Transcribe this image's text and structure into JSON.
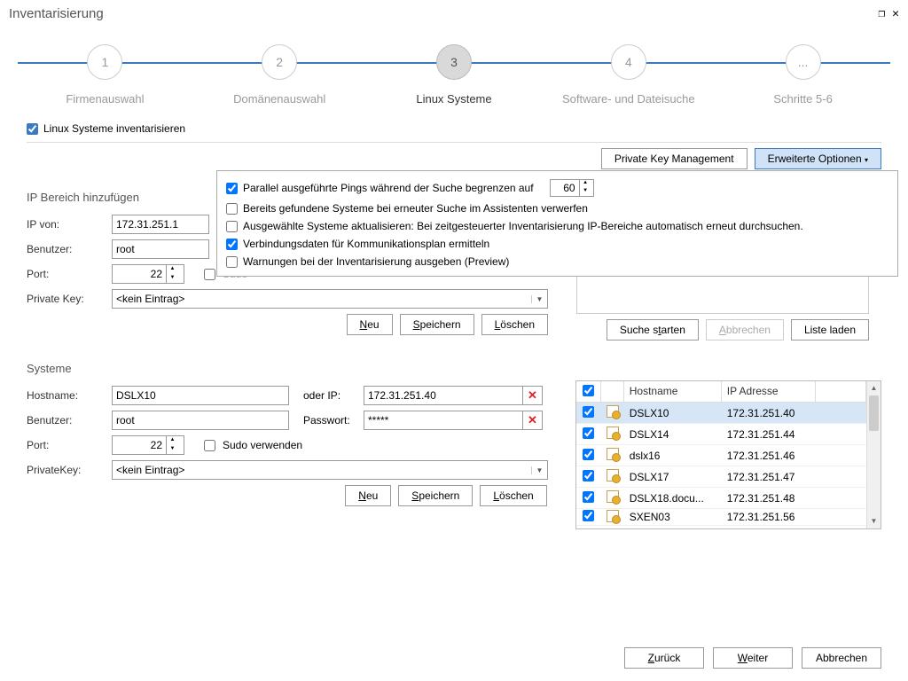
{
  "window": {
    "title": "Inventarisierung"
  },
  "wizard": {
    "steps": [
      {
        "num": "1",
        "label": "Firmenauswahl"
      },
      {
        "num": "2",
        "label": "Domänenauswahl"
      },
      {
        "num": "3",
        "label": "Linux Systeme"
      },
      {
        "num": "4",
        "label": "Software- und Dateisuche"
      },
      {
        "num": "...",
        "label": "Schritte 5-6"
      }
    ]
  },
  "top_checkbox": {
    "label": "Linux Systeme inventarisieren"
  },
  "top_buttons": {
    "pkm": "Private Key Management",
    "ext": "Erweiterte Optionen"
  },
  "options": {
    "o1_pre": "Parallel ausgeführte Pings während der Suche begrenzen auf",
    "o1_val": "60",
    "o2": "Bereits gefundene Systeme bei erneuter Suche im Assistenten verwerfen",
    "o3": "Ausgewählte Systeme aktualisieren: Bei zeitgesteuerter Inventarisierung IP-Bereiche automatisch erneut durchsuchen.",
    "o4": "Verbindungsdaten für Kommunikationsplan ermitteln",
    "o5": "Warnungen bei der Inventarisierung ausgeben (Preview)"
  },
  "iprange": {
    "title": "IP Bereich hinzufügen",
    "ip_from_lbl": "IP von:",
    "ip_from_val": "172.31.251.1",
    "user_lbl": "Benutzer:",
    "user_val": "root",
    "port_lbl": "Port:",
    "port_val": "22",
    "sudo_lbl": "Sudo",
    "pk_lbl": "Private Key:",
    "pk_val": "<kein Eintrag>",
    "btn_new": "Neu",
    "btn_save": "Speichern",
    "btn_del": "Löschen",
    "btn_search": "Suche starten",
    "btn_cancel": "Abbrechen",
    "btn_load": "Liste laden"
  },
  "systems": {
    "title": "Systeme",
    "host_lbl": "Hostname:",
    "host_val": "DSLX10",
    "or_ip_lbl": "oder IP:",
    "or_ip_val": "172.31.251.40",
    "user_lbl": "Benutzer:",
    "user_val": "root",
    "pass_lbl": "Passwort:",
    "pass_val": "*****",
    "port_lbl": "Port:",
    "port_val": "22",
    "sudo_lbl": "Sudo verwenden",
    "pk_lbl": "PrivateKey:",
    "pk_val": "<kein Eintrag>",
    "btn_new": "Neu",
    "btn_save": "Speichern",
    "btn_del": "Löschen"
  },
  "table": {
    "col_host": "Hostname",
    "col_ip": "IP Adresse",
    "rows": [
      {
        "host": "DSLX10",
        "ip": "172.31.251.40"
      },
      {
        "host": "DSLX14",
        "ip": "172.31.251.44"
      },
      {
        "host": "dslx16",
        "ip": "172.31.251.46"
      },
      {
        "host": "DSLX17",
        "ip": "172.31.251.47"
      },
      {
        "host": "DSLX18.docu...",
        "ip": "172.31.251.48"
      },
      {
        "host": "SXEN03",
        "ip": "172.31.251.56"
      }
    ]
  },
  "nav": {
    "back": "Zurück",
    "next": "Weiter",
    "cancel": "Abbrechen"
  }
}
